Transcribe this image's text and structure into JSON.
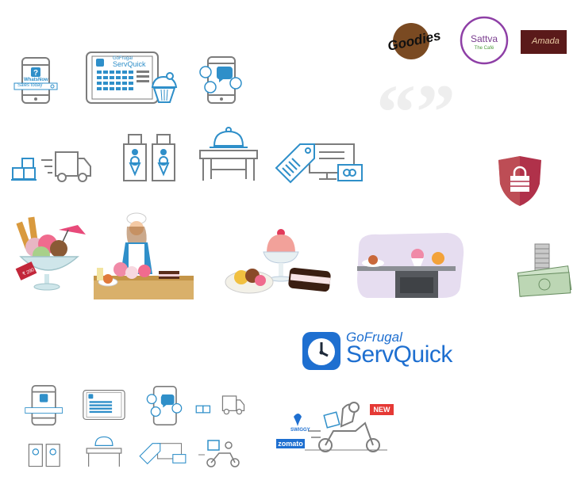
{
  "icons": {
    "whatsnow_label": "WhatsNow",
    "sales_today": "Sales today",
    "servquick_brand": "GoFrugal",
    "servquick_product": "ServQuick",
    "tag_price": "₹ 290"
  },
  "logos": {
    "goodies": "Goodies",
    "sattva_name": "Sattva",
    "sattva_sub": "The Café",
    "third_brand": "Amada"
  },
  "main_logo": {
    "brand": "GoFrugal",
    "product": "ServQuick"
  },
  "delivery": {
    "badge": "NEW",
    "swiggy": "SWIGGY",
    "zomato": "zomato"
  },
  "colors": {
    "blue": "#2f8fc9",
    "gray": "#7c7c7c",
    "shield": "#b0314a",
    "logo_blue": "#1e6fd0",
    "badge_red": "#e53935"
  }
}
